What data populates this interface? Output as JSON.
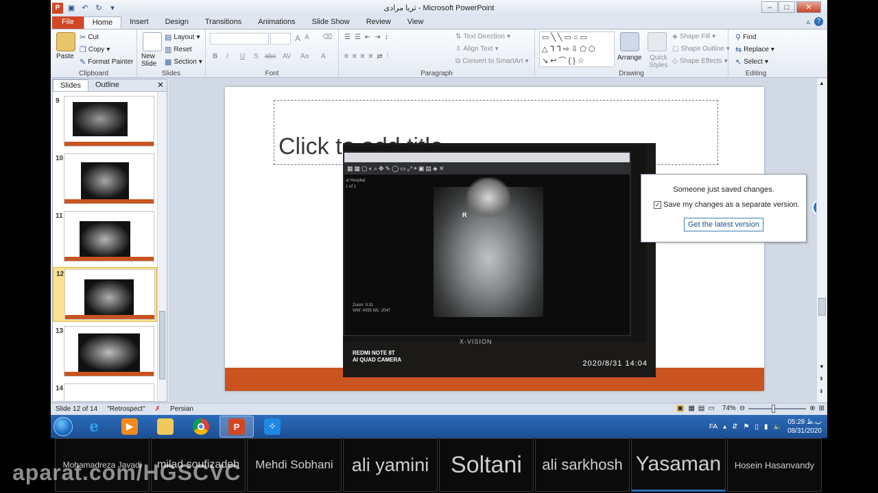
{
  "window": {
    "title": "ثریا مرادی  -  Microsoft PowerPoint",
    "controls": [
      "–",
      "□",
      "✕"
    ]
  },
  "tabs": [
    "File",
    "Home",
    "Insert",
    "Design",
    "Transitions",
    "Animations",
    "Slide Show",
    "Review",
    "View"
  ],
  "active_tab": "Home",
  "ribbon": {
    "clipboard": {
      "label": "Clipboard",
      "paste": "Paste",
      "cut": "Cut",
      "copy": "Copy",
      "format_painter": "Format Painter"
    },
    "slides": {
      "label": "Slides",
      "new_slide": "New Slide",
      "layout": "Layout",
      "reset": "Reset",
      "section": "Section"
    },
    "font": {
      "label": "Font",
      "bold": "B",
      "italic": "I",
      "underline": "U",
      "strike": "S",
      "spacing": "abc",
      "shadow": "AV",
      "case": "Aa"
    },
    "paragraph": {
      "label": "Paragraph",
      "text_direction": "Text Direction",
      "align_text": "Align Text",
      "convert_smartart": "Convert to SmartArt"
    },
    "drawing": {
      "label": "Drawing",
      "arrange": "Arrange",
      "quick_styles": "Quick Styles",
      "shape_fill": "Shape Fill",
      "shape_outline": "Shape Outline",
      "shape_effects": "Shape Effects"
    },
    "editing": {
      "label": "Editing",
      "find": "Find",
      "replace": "Replace",
      "select": "Select"
    }
  },
  "left_pane": {
    "tabs": [
      "Slides",
      "Outline"
    ],
    "active": "Slides",
    "thumbnails": [
      {
        "num": "9"
      },
      {
        "num": "10"
      },
      {
        "num": "11"
      },
      {
        "num": "12",
        "selected": true
      },
      {
        "num": "13"
      },
      {
        "num": "14"
      }
    ]
  },
  "slide": {
    "title_placeholder": "Click to add title",
    "photo": {
      "brand": "X-VISION",
      "camera_line1": "REDMI NOTE 8T",
      "camera_line2": "AI QUAD CAMERA",
      "datetime": "2020/8/31  14:04",
      "marker": "R",
      "hospital": "at Hospital",
      "page": "1 of 1",
      "zoom": "Zoom: 0.31",
      "wl": "WW: 4095  WL: 2047"
    }
  },
  "notification": {
    "message": "Someone just saved changes.",
    "checkbox_label": "Save my changes as a separate version.",
    "checked": true,
    "button": "Get the latest version"
  },
  "status": {
    "slide": "Slide 12 of 14",
    "theme": "\"Retrospect\"",
    "language": "Persian",
    "zoom": "74%"
  },
  "taskbar": {
    "lang": "FA",
    "time": "05:28 ب.ظ",
    "date": "08/31/2020"
  },
  "participants": [
    "Mohamadreza Javadi",
    "milad soufizadeh",
    "Mehdi Sobhani",
    "ali yamini",
    "Soltani",
    "ali sarkhosh",
    "Yasaman",
    "Hosein Hasanvandy"
  ],
  "watermark": "aparat.com/HGSCVC"
}
